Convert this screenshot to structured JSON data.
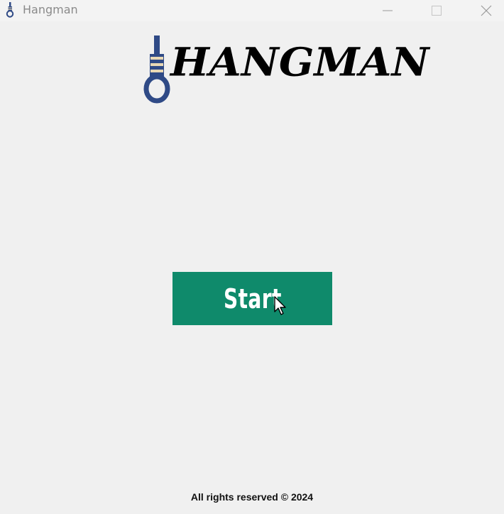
{
  "window": {
    "title": "Hangman",
    "app_icon": "noose-icon",
    "controls": {
      "minimize": "minimize-icon",
      "maximize": "maximize-icon",
      "close": "close-icon"
    }
  },
  "logo": {
    "text": "HANGMAN",
    "icon": "noose-icon"
  },
  "start_button": {
    "label": "Start",
    "color": "#0f8a6b"
  },
  "footer": {
    "text": "All rights reserved © 2024"
  },
  "colors": {
    "background": "#f0f0f0",
    "noose": "#2f4a86",
    "noose_band": "#e9d9b5"
  }
}
